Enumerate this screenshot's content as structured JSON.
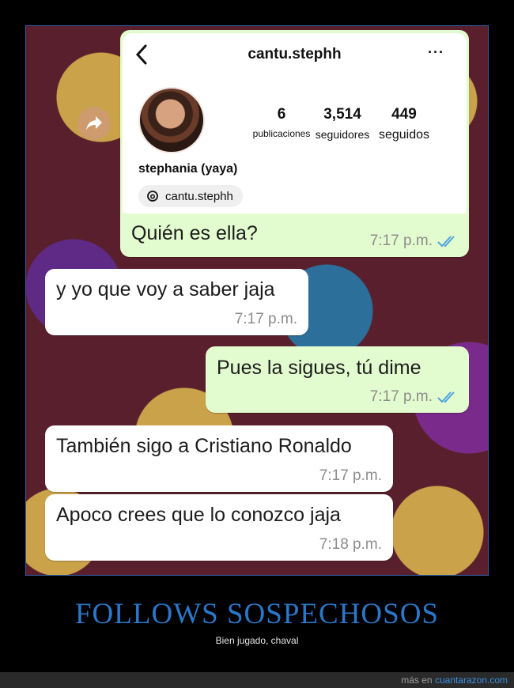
{
  "profile": {
    "username": "cantu.stephh",
    "stats": [
      {
        "value": "6",
        "label": "publicaciones"
      },
      {
        "value": "3,514",
        "label": "seguidores"
      },
      {
        "value": "449",
        "label": "seguidos"
      }
    ],
    "display_name": "stephania (yaya)",
    "threads_handle": "cantu.stephh",
    "more_label": "···"
  },
  "messages": [
    {
      "direction": "out",
      "text": "Quién es ella?",
      "time": "7:17 p.m.",
      "read": true
    },
    {
      "direction": "in",
      "text": "y yo que voy a saber jaja",
      "time": "7:17 p.m."
    },
    {
      "direction": "out",
      "text": "Pues la sigues, tú dime",
      "time": "7:17 p.m.",
      "read": true
    },
    {
      "direction": "in",
      "text": "También sigo a Cristiano Ronaldo",
      "time": "7:17 p.m."
    },
    {
      "direction": "in",
      "text": "Apoco crees que lo conozco jaja",
      "time": "7:18 p.m."
    }
  ],
  "caption": {
    "title": "FOLLOWS SOSPECHOSOS",
    "subtitle": "Bien jugado, chaval"
  },
  "footer": {
    "prefix": "más en",
    "site": "cuantarazon.com"
  },
  "colors": {
    "accent_title": "#2a77c9",
    "outgoing_bubble": "#e3fccf",
    "incoming_bubble": "#ffffff",
    "read_ticks": "#4fa3e0",
    "background": "#5a1f2c"
  }
}
